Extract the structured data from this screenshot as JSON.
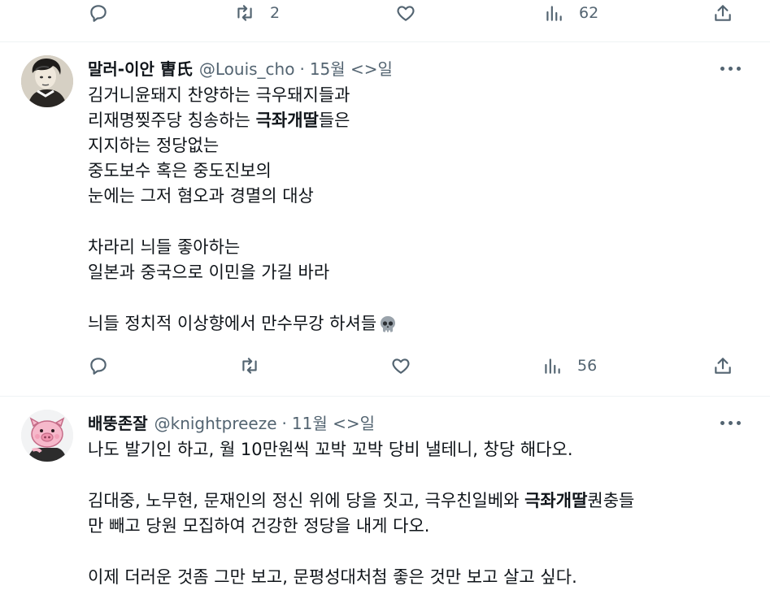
{
  "top_actions": {
    "reply_count": "",
    "retweet_count": "2",
    "like_count": "",
    "views_count": "62"
  },
  "tweets": [
    {
      "name": "말러-이안 曺氏",
      "handle": "@Louis_cho",
      "separator": "·",
      "time": "15월 <>일",
      "lines": [
        {
          "pre": "김거니윤돼지 찬양하는 극우돼지들과",
          "bold": "",
          "post": ""
        },
        {
          "pre": "리재명찢주당 칭송하는 ",
          "bold": "극좌개딸",
          "post": "들은"
        },
        {
          "pre": "지지하는 정당없는",
          "bold": "",
          "post": ""
        },
        {
          "pre": "중도보수 혹은 중도진보의",
          "bold": "",
          "post": ""
        },
        {
          "pre": "눈에는 그저 혐오과 경멸의 대상",
          "bold": "",
          "post": ""
        },
        {
          "pre": "차라리 늬들 좋아하는",
          "bold": "",
          "post": ""
        },
        {
          "pre": "일본과 중국으로 이민을 가길 바라",
          "bold": "",
          "post": ""
        },
        {
          "pre": "늬들 정치적 이상향에서 만수무강 하셔들",
          "bold": "",
          "post": ""
        }
      ],
      "emoji_icon": "skull-icon",
      "actions": {
        "reply_count": "",
        "retweet_count": "",
        "like_count": "",
        "views_count": "56"
      }
    },
    {
      "name": "배뚱존잘",
      "handle": "@knightpreeze",
      "separator": "·",
      "time": "11월 <>일",
      "lines": [
        {
          "pre": "나도 발기인 하고, 월 10만원씩 꼬박 꼬박 당비 낼테니, 창당 해다오.",
          "bold": "",
          "post": ""
        },
        {
          "pre": "김대중, 노무현, 문재인의 정신 위에 당을 짓고, 극우친일베와 ",
          "bold": "극좌개딸",
          "post": "퀀충들"
        },
        {
          "pre": "만 빼고 당원 모집하여 건강한 정당을 내게 다오.",
          "bold": "",
          "post": ""
        },
        {
          "pre": "이제 더러운 것좀 그만 보고, 문평성대처첨 좋은 것만 보고 살고 싶다.",
          "bold": "",
          "post": ""
        }
      ]
    }
  ],
  "colors": {
    "text_primary": "#0f1419",
    "text_secondary": "#536471",
    "divider": "#eff3f4"
  }
}
